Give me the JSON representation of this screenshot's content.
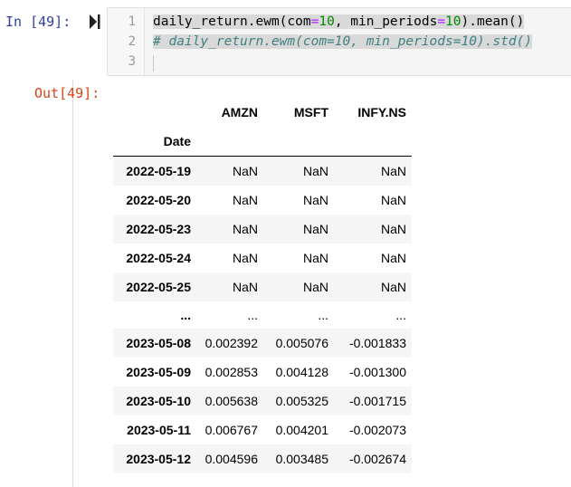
{
  "input_cell": {
    "prompt": "In [49]:",
    "line_numbers": [
      "1",
      "2",
      "3"
    ],
    "lines": [
      {
        "tokens": [
          {
            "text": "daily_return.ewm(com",
            "cls": ""
          },
          {
            "text": "=",
            "cls": "op"
          },
          {
            "text": "10",
            "cls": "num"
          },
          {
            "text": ", min_periods",
            "cls": ""
          },
          {
            "text": "=",
            "cls": "op"
          },
          {
            "text": "10",
            "cls": "num"
          },
          {
            "text": ").mean()",
            "cls": ""
          }
        ]
      },
      {
        "tokens": [
          {
            "text": "# daily_return.ewm(com=10, min_periods=10).std()",
            "cls": "comment"
          }
        ]
      },
      {
        "tokens": []
      }
    ]
  },
  "output_cell": {
    "prompt": "Out[49]:",
    "table": {
      "columns": [
        "AMZN",
        "MSFT",
        "INFY.NS"
      ],
      "index_name": "Date",
      "rows": [
        {
          "date": "2022-05-19",
          "values": [
            "NaN",
            "NaN",
            "NaN"
          ]
        },
        {
          "date": "2022-05-20",
          "values": [
            "NaN",
            "NaN",
            "NaN"
          ]
        },
        {
          "date": "2022-05-23",
          "values": [
            "NaN",
            "NaN",
            "NaN"
          ]
        },
        {
          "date": "2022-05-24",
          "values": [
            "NaN",
            "NaN",
            "NaN"
          ]
        },
        {
          "date": "2022-05-25",
          "values": [
            "NaN",
            "NaN",
            "NaN"
          ]
        },
        {
          "date": "...",
          "values": [
            "...",
            "...",
            "..."
          ]
        },
        {
          "date": "2023-05-08",
          "values": [
            "0.002392",
            "0.005076",
            "-0.001833"
          ]
        },
        {
          "date": "2023-05-09",
          "values": [
            "0.002853",
            "0.004128",
            "-0.001300"
          ]
        },
        {
          "date": "2023-05-10",
          "values": [
            "0.005638",
            "0.005325",
            "-0.001715"
          ]
        },
        {
          "date": "2023-05-11",
          "values": [
            "0.006767",
            "0.004201",
            "-0.002073"
          ]
        },
        {
          "date": "2023-05-12",
          "values": [
            "0.004596",
            "0.003485",
            "-0.002674"
          ]
        }
      ]
    }
  },
  "icons": {
    "run": "run-cell-icon"
  }
}
